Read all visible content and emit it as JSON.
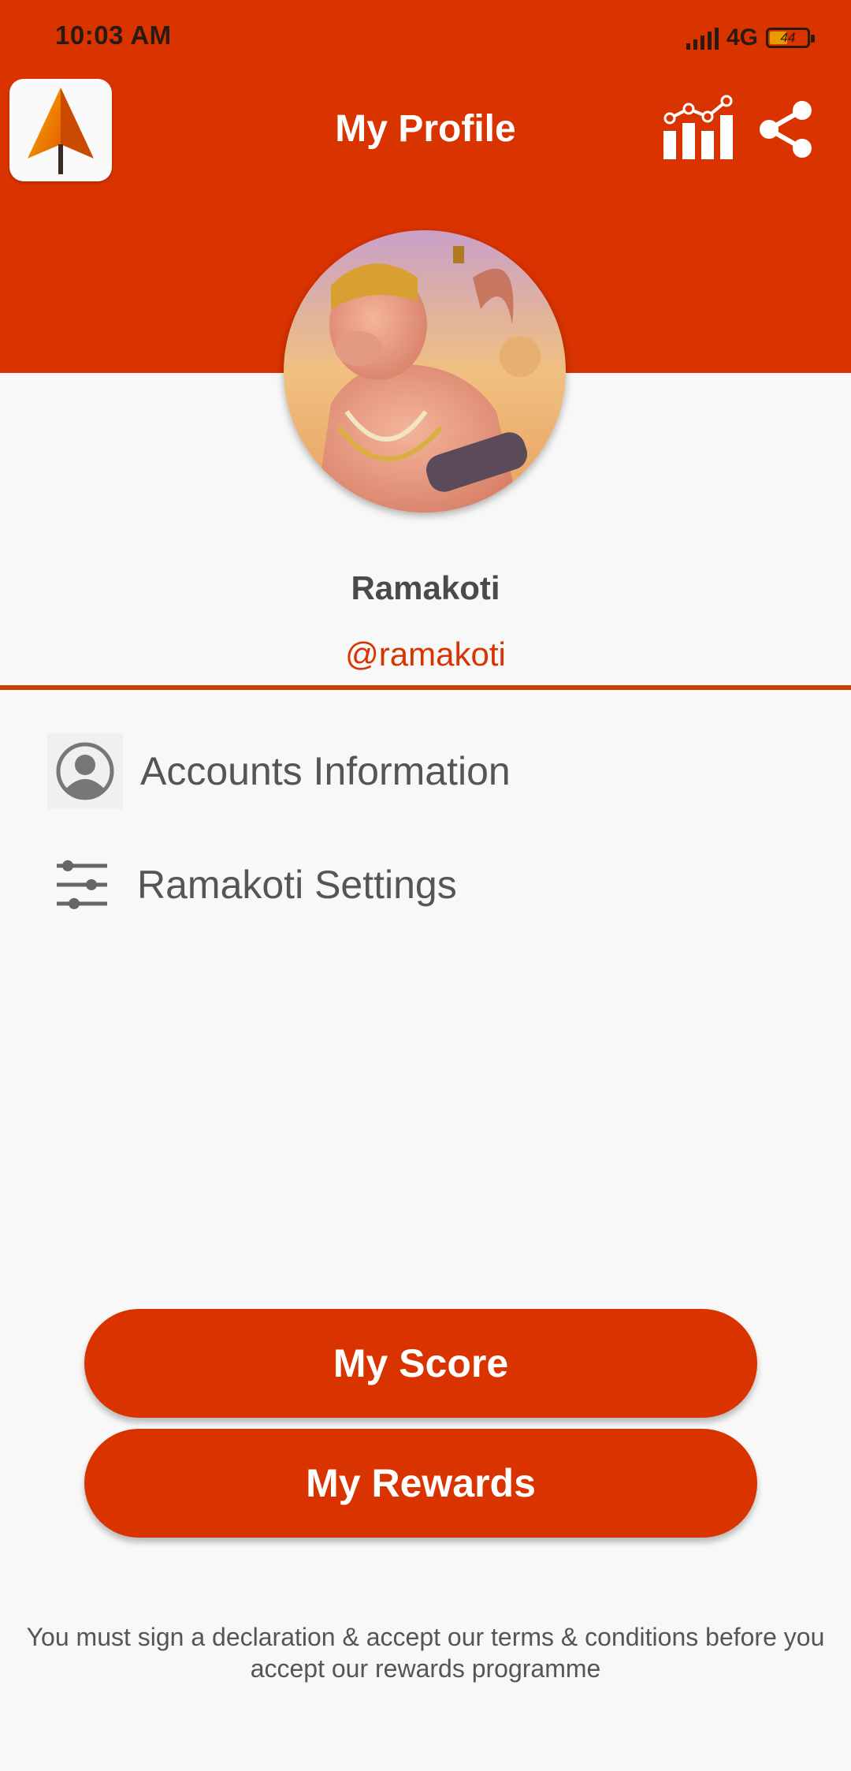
{
  "status_bar": {
    "time": "10:03 AM",
    "network": "4G",
    "battery": "44"
  },
  "header": {
    "title": "My Profile",
    "logo_icon": "arrow-up-logo-icon",
    "stats_icon": "stats-chart-icon",
    "share_icon": "share-icon",
    "background_color": "#d93300"
  },
  "profile": {
    "name": "Ramakoti",
    "handle": "@ramakoti",
    "avatar_icon": "hanuman-avatar-image"
  },
  "menu": {
    "items": [
      {
        "label": "Accounts Information",
        "icon": "user-circle-icon"
      },
      {
        "label": "Ramakoti Settings",
        "icon": "sliders-icon"
      }
    ]
  },
  "buttons": {
    "score": "My Score",
    "rewards": "My Rewards"
  },
  "footer": {
    "disclaimer": "You must sign a declaration & accept our terms & conditions before you accept our rewards programme"
  },
  "colors": {
    "accent": "#d93300",
    "text_gray": "#555555"
  }
}
